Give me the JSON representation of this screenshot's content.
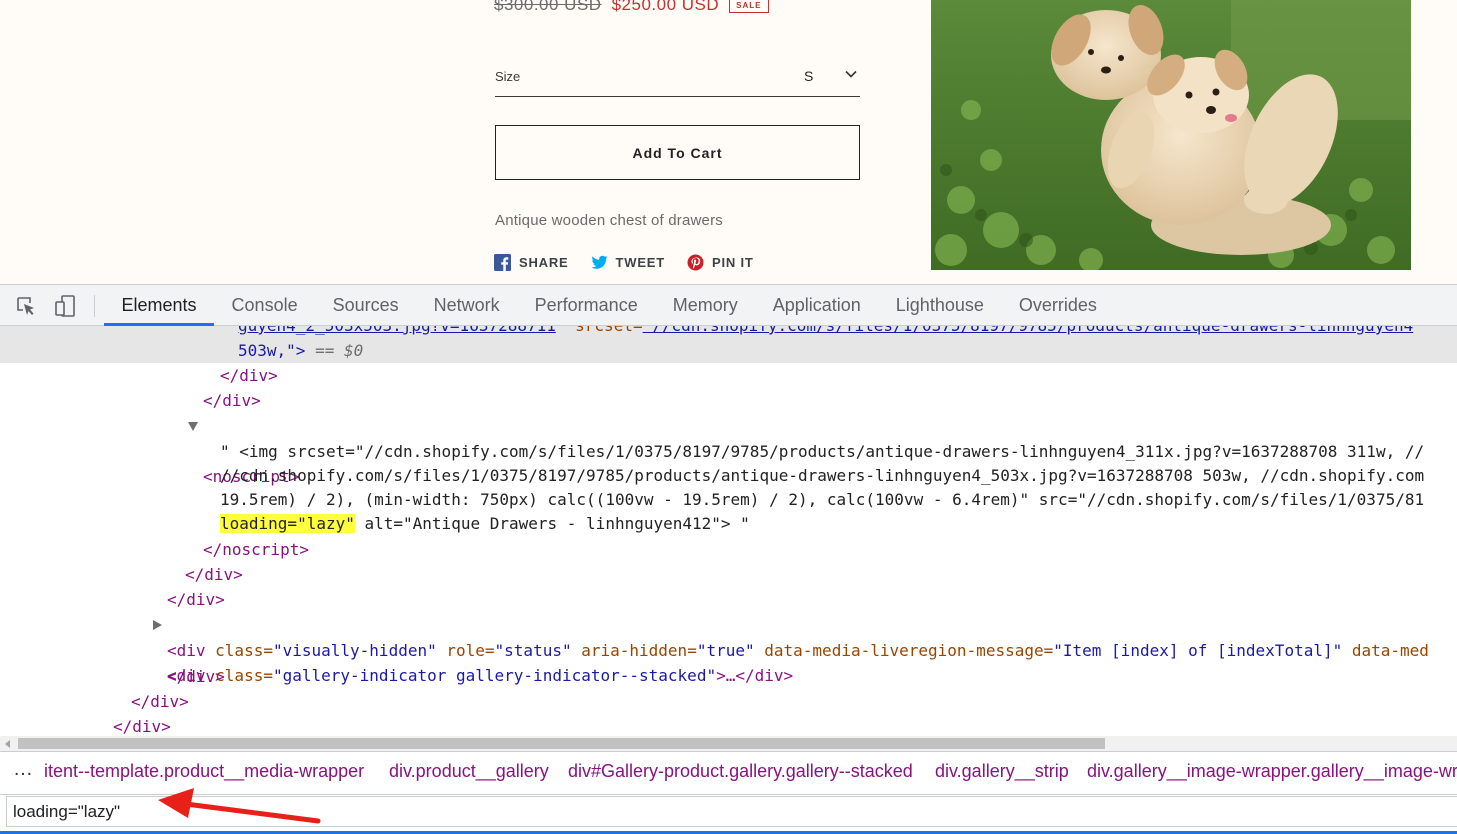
{
  "product": {
    "price_old": "$300.00 USD",
    "price_new": "$250.00 USD",
    "sale_badge": "SALE",
    "size_label": "Size",
    "size_value": "S",
    "add_to_cart_label": "Add To Cart",
    "description": "Antique wooden chest of drawers",
    "share": [
      {
        "label": "SHARE",
        "icon": "facebook-icon",
        "color": "#3b5998"
      },
      {
        "label": "TWEET",
        "icon": "twitter-icon",
        "color": "#00aced"
      },
      {
        "label": "PIN IT",
        "icon": "pinterest-icon",
        "color": "#cb2027"
      }
    ],
    "image_subject": "puppies-photo"
  },
  "devtools": {
    "tabs": [
      "Elements",
      "Console",
      "Sources",
      "Network",
      "Performance",
      "Memory",
      "Application",
      "Lighthouse",
      "Overrides"
    ],
    "active_tab": "Elements",
    "code": {
      "l0_a": "guyen4_2_503x503.jpg?v=1637288711",
      "l0_b": "srcset=",
      "l0_c": "\"//cdn.shopify.com/s/files/1/0375/8197/9785/products/antique-drawers-linhnguyen4",
      "l1_a": "503w,\">",
      "l1_b": "== $0",
      "l2": "</div>",
      "l3": "</div>",
      "l4": "<noscript>",
      "l5": "\" <img srcset=\"//cdn.shopify.com/s/files/1/0375/8197/9785/products/antique-drawers-linhnguyen4_311x.jpg?v=1637288708 311w, //",
      "l6": "//cdn.shopify.com/s/files/1/0375/8197/9785/products/antique-drawers-linhnguyen4_503x.jpg?v=1637288708 503w, //cdn.shopify.com",
      "l7": "19.5rem) / 2), (min-width: 750px) calc((100vw - 19.5rem) / 2), calc(100vw - 6.4rem)\" src=\"//cdn.shopify.com/s/files/1/0375/81",
      "l8_hl": "loading=\"lazy\"",
      "l8_rest": " alt=\"Antique Drawers - linhnguyen412\"> \"",
      "l9": "</noscript>",
      "l10": "</div>",
      "l11": "</div>",
      "l12_open": "<div",
      "l12_attr": " class=",
      "l12_val": "\"gallery-indicator gallery-indicator--stacked\"",
      "l12_close": ">…</div>",
      "l13_open": "<div",
      "l13_a1": " class=",
      "l13_v1": "\"visually-hidden\"",
      "l13_a2": " role=",
      "l13_v2": "\"status\"",
      "l13_a3": " aria-hidden=",
      "l13_v3": "\"true\"",
      "l13_a4": " data-media-liveregion-message=",
      "l13_v4": "\"Item [index] of [indexTotal]\"",
      "l13_a5": " data-med",
      "l14": "</div>",
      "l15": "</div>",
      "l16": "</div>"
    },
    "breadcrumbs": {
      "more": "…",
      "items": [
        "itent--template.product__media-wrapper",
        "div.product__gallery",
        "div#Gallery-product.gallery.gallery--stacked",
        "div.gallery__strip",
        "div.gallery__image-wrapper.gallery__image-wra"
      ]
    },
    "search_value": "loading=\"lazy\""
  },
  "colors": {
    "accent": "#1a73e8",
    "sale": "#c8302d",
    "annotation_arrow": "#e8201a",
    "highlight": "#ffff3d"
  }
}
